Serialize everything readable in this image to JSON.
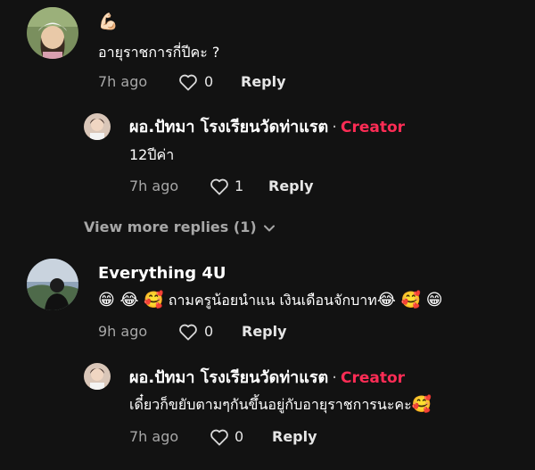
{
  "thread1": {
    "top": {
      "name_emoji": "💪🏻",
      "text": "อายุราชการกี่ปีคะ ?",
      "time": "7h ago",
      "likes": "0",
      "reply_label": "Reply"
    },
    "reply": {
      "name": "ผอ.ปัทมา โรงเรียนวัดท่าแรต",
      "separator": "·",
      "badge": "Creator",
      "text": "12ปีค่า",
      "time": "7h ago",
      "likes": "1",
      "reply_label": "Reply"
    },
    "view_more": "View more replies (1)"
  },
  "thread2": {
    "top": {
      "name": "Everything 4U",
      "text_emoji_1": "😁 😂 🥰",
      "text": "ถามครูน้อยนำแน เงินเดือนจักบาท",
      "text_emoji_2": "😂 🥰 😁",
      "time": "9h ago",
      "likes": "0",
      "reply_label": "Reply"
    },
    "reply": {
      "name": "ผอ.ปัทมา โรงเรียนวัดท่าแรต",
      "separator": "·",
      "badge": "Creator",
      "text": "เดี๋ยวก็ขยับตามๆกันขึ้นอยู่กับอายุราชการนะคะ",
      "text_emoji": "🥰",
      "time": "7h ago",
      "likes": "0",
      "reply_label": "Reply"
    }
  },
  "icons": {
    "like": "heart-outline-icon",
    "expand": "chevron-down-icon"
  },
  "colors": {
    "background": "#121212",
    "creator_badge": "#fe2c55",
    "secondary_text": "#a7a7a7"
  }
}
